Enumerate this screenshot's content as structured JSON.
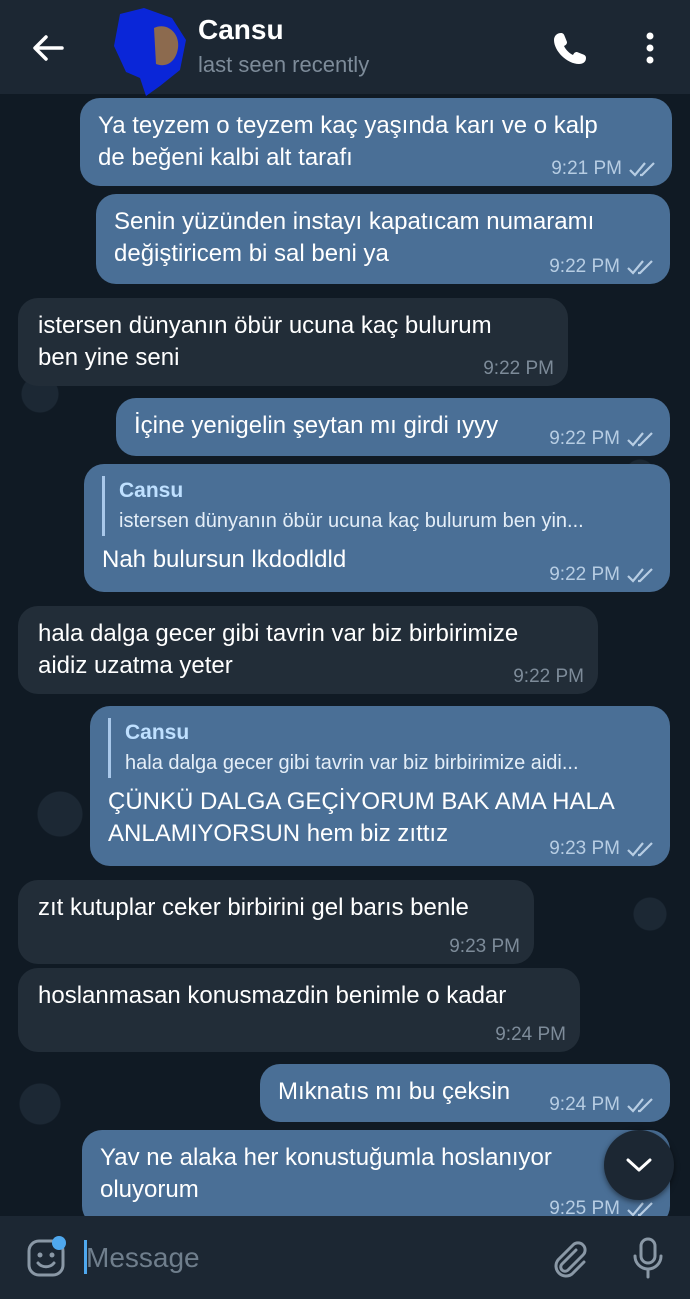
{
  "header": {
    "contact_name": "Cansu",
    "status": "last seen recently"
  },
  "messages": [
    {
      "text": "Ya teyzem o teyzem kaç yaşında karı ve o kalp\nde beğeni kalbi alt tarafı",
      "time": "9:21 PM"
    },
    {
      "text": "Senin yüzünden instayı kapatıcam numaramı\ndeğiştiricem bi sal beni ya",
      "time": "9:22 PM"
    },
    {
      "text": "istersen dünyanın öbür ucuna kaç bulurum\nben yine seni",
      "time": "9:22 PM"
    },
    {
      "text": "İçine yenigelin şeytan mı girdi ıyyy",
      "time": "9:22 PM"
    },
    {
      "quote_name": "Cansu",
      "quote_text": "istersen dünyanın öbür ucuna kaç bulurum ben yin...",
      "text": "Nah bulursun lkdodldld",
      "time": "9:22 PM"
    },
    {
      "text": "hala dalga gecer gibi tavrin var biz birbirimize\naidiz uzatma yeter",
      "time": "9:22 PM"
    },
    {
      "quote_name": "Cansu",
      "quote_text": "hala dalga gecer gibi tavrin var biz birbirimize aidi...",
      "text": "ÇÜNKÜ DALGA GEÇİYORUM BAK AMA HALA\nANLAMIYORSUN hem biz zıttız",
      "time": "9:23 PM"
    },
    {
      "text": "zıt kutuplar ceker birbirini gel barıs benle",
      "time": "9:23 PM"
    },
    {
      "text": "hoslanmasan konusmazdin benimle o kadar",
      "time": "9:24 PM"
    },
    {
      "text": "Mıknatıs mı bu çeksin",
      "time": "9:24 PM"
    },
    {
      "text": "Yav ne alaka her konustuğumla hoslanıyor\noluyorum",
      "time": "9:25 PM"
    }
  ],
  "composer": {
    "placeholder": "Message"
  },
  "colors": {
    "outgoing_bubble": "#4a6f96",
    "incoming_bubble": "#222d38",
    "accent": "#4fa8ee"
  }
}
